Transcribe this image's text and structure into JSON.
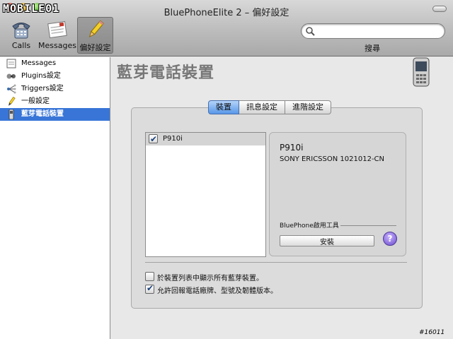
{
  "window": {
    "title": "BluePhoneElite 2 – 偏好設定",
    "watermark": "MOBILE01"
  },
  "toolbar": {
    "items": [
      {
        "label": "Calls",
        "icon": "phone-icon"
      },
      {
        "label": "Messages",
        "icon": "letter-icon"
      },
      {
        "label": "偏好設定",
        "icon": "pencil-icon",
        "selected": true
      }
    ]
  },
  "search": {
    "value": "",
    "placeholder": "",
    "label": "搜尋"
  },
  "sidebar": {
    "items": [
      {
        "label": "Messages",
        "icon": "messages-icon"
      },
      {
        "label": "Plugins設定",
        "icon": "plugins-icon"
      },
      {
        "label": "Triggers設定",
        "icon": "triggers-icon"
      },
      {
        "label": "一般設定",
        "icon": "pencil-icon"
      },
      {
        "label": "藍芽電話裝置",
        "icon": "bluetooth-phone-icon",
        "selected": true
      }
    ]
  },
  "main": {
    "title": "藍芽電話裝置",
    "tabs": [
      {
        "label": "裝置",
        "active": true
      },
      {
        "label": "訊息設定"
      },
      {
        "label": "進階設定"
      }
    ],
    "devices": [
      {
        "name": "P910i",
        "checked": true
      }
    ],
    "device_info": {
      "name": "P910i",
      "model": "SONY ERICSSON 1021012-CN",
      "tool_label": "BluePhone啟用工具",
      "install_label": "安裝",
      "help_label": "?"
    },
    "options": [
      {
        "label": "於裝置列表中顯示所有藍芽裝置。",
        "checked": false
      },
      {
        "label": "允許回報電話廠牌、型號及韌體版本。",
        "checked": true
      }
    ]
  },
  "footer_tag": "#16011",
  "colors": {
    "selection": "#3875d7",
    "tab_active": "#5897e8",
    "title_gray": "#777777"
  }
}
